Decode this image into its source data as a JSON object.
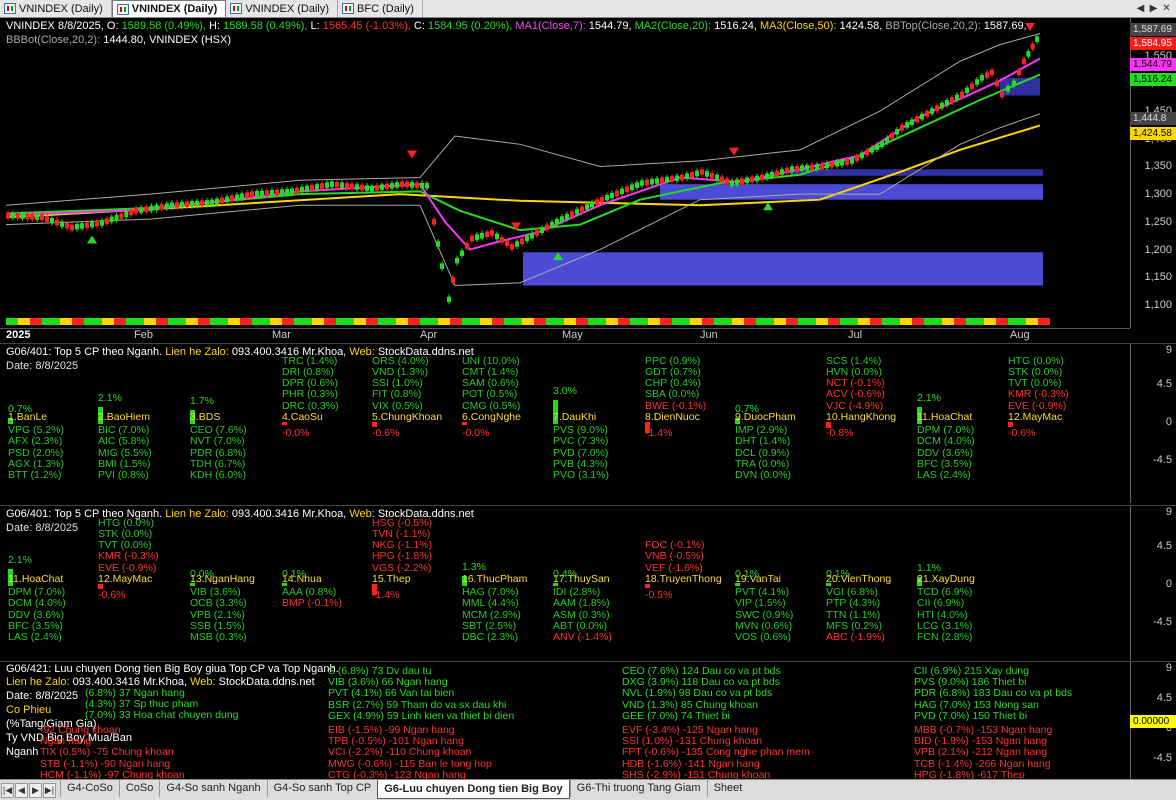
{
  "window_tabs": [
    {
      "label": "VNINDEX (Daily)",
      "active": false
    },
    {
      "label": "VNINDEX (Daily)",
      "active": true
    },
    {
      "label": "VNINDEX (Daily)",
      "active": false
    },
    {
      "label": "BFC (Daily)",
      "active": false
    }
  ],
  "price_header": {
    "line1": [
      {
        "t": "VNINDEX 8/8/2025, ",
        "c": "w"
      },
      {
        "t": "O: ",
        "c": "w"
      },
      {
        "t": "1589.58 (0.49%), ",
        "c": "g"
      },
      {
        "t": "H: ",
        "c": "w"
      },
      {
        "t": "1589.58 (0.49%), ",
        "c": "g"
      },
      {
        "t": "L: ",
        "c": "w"
      },
      {
        "t": "1565.45 (-1.03%), ",
        "c": "r"
      },
      {
        "t": "C: ",
        "c": "w"
      },
      {
        "t": "1584.95 (0.20%), ",
        "c": "g"
      },
      {
        "t": "MA1(Close,7): ",
        "c": "m"
      },
      {
        "t": "1544.79, ",
        "c": "w"
      },
      {
        "t": "MA2(Close,20): ",
        "c": "g"
      },
      {
        "t": "1516.24, ",
        "c": "w"
      },
      {
        "t": "MA3(Close,50): ",
        "c": "o"
      },
      {
        "t": "1424.58, ",
        "c": "w"
      },
      {
        "t": "BBTop(Close,20,2): ",
        "c": "gg"
      },
      {
        "t": "1587.69,",
        "c": "w"
      }
    ],
    "line2": [
      {
        "t": "BBBot(Close,20,2): ",
        "c": "gg"
      },
      {
        "t": "1444.80, ",
        "c": "w"
      },
      {
        "t": "VNINDEX (HSX)",
        "c": "w"
      }
    ]
  },
  "price_scale": {
    "ticks": [
      "1,550",
      "1,500",
      "1,450",
      "1,400",
      "1,350",
      "1,300",
      "1,250",
      "1,200",
      "1,150",
      "1,100"
    ],
    "tags": [
      {
        "label": "1,587.69",
        "bg": "#444444",
        "fg": "#dddddd"
      },
      {
        "label": "1,584.95",
        "bg": "#ff1a1a",
        "fg": "#ffffff"
      },
      {
        "label": "1,544.79",
        "bg": "#ff33ff",
        "fg": "#000000"
      },
      {
        "label": "1,516.24",
        "bg": "#22dd22",
        "fg": "#000000"
      },
      {
        "label": "1,444.8",
        "bg": "#444444",
        "fg": "#dddddd"
      },
      {
        "label": "1,424.58",
        "bg": "#ffd700",
        "fg": "#000000"
      }
    ]
  },
  "dates": [
    "2025",
    "Feb",
    "Mar",
    "Apr",
    "May",
    "Jun",
    "Jul",
    "Aug"
  ],
  "ind1": {
    "title": [
      {
        "t": "G06/401: Top 5 CP theo Nganh. ",
        "c": "w"
      },
      {
        "t": "Lien he Zalo: ",
        "c": "o"
      },
      {
        "t": "093.400.3416 Mr.Khoa, ",
        "c": "w"
      },
      {
        "t": "Web: ",
        "c": "o"
      },
      {
        "t": "StockData.ddns.net",
        "c": "w"
      }
    ],
    "date": "Date: 8/8/2025",
    "scale": [
      "9",
      "4.5",
      "0",
      "-4.5"
    ],
    "sectors": [
      {
        "name": "1.BanLe",
        "pct": "0.7%",
        "neg": false,
        "above": [],
        "below": [
          "VPG (5.2%)",
          "AFX (2.3%)",
          "PSD (2.0%)",
          "AGX (1.3%)",
          "BTT (1.2%)"
        ]
      },
      {
        "name": "2.BaoHiem",
        "pct": "2.1%",
        "neg": false,
        "above": [],
        "below": [
          "BIC (7.0%)",
          "AIC (5.8%)",
          "MIG (5.5%)",
          "BMI (1.5%)",
          "PVI (0.8%)"
        ]
      },
      {
        "name": "3.BDS",
        "pct": "1.7%",
        "neg": false,
        "above": [],
        "below": [
          "CEO (7.6%)",
          "NVT (7.0%)",
          "PDR (6.8%)",
          "TDH (6.7%)",
          "KDH (6.0%)"
        ]
      },
      {
        "name": "4.CaoSu",
        "pct": "-0.0%",
        "neg": true,
        "above": [
          "TRC (1.4%)",
          "DRI (0.8%)",
          "DPR (0.6%)",
          "PHR (0.3%)",
          "DRC (0.3%)"
        ],
        "below": []
      },
      {
        "name": "5.ChungKhoan",
        "pct": "-0.6%",
        "neg": true,
        "above": [
          "ORS (4.0%)",
          "VND (1.3%)",
          "SSI (1.0%)",
          "FIT (0.8%)",
          "VIX (0.5%)"
        ],
        "below": []
      },
      {
        "name": "6.CongNghe",
        "pct": "-0.0%",
        "neg": true,
        "above": [
          "UNI (10.0%)",
          "CMT (1.4%)",
          "SAM (0.6%)",
          "POT (0.5%)",
          "CMG (0.5%)"
        ],
        "below": []
      },
      {
        "name": "7.DauKhi",
        "pct": "3.0%",
        "neg": false,
        "above": [],
        "below": [
          "PVS (9.0%)",
          "PVC (7.3%)",
          "PVD (7.0%)",
          "PVB (4.3%)",
          "PVO (3.1%)"
        ]
      },
      {
        "name": "8.DienNuoc",
        "pct": "-1.4%",
        "neg": true,
        "above": [
          "PPC (0.9%)",
          "GDT (0.7%)",
          "CHP (0.4%)",
          "SBA (0.0%)",
          "BWE (-0.1%)"
        ],
        "below": []
      },
      {
        "name": "9.DuocPham",
        "pct": "0.7%",
        "neg": false,
        "above": [],
        "below": [
          "IMP (2.9%)",
          "DHT (1.4%)",
          "DCL (0.9%)",
          "TRA (0.0%)",
          "DVN (0.0%)"
        ]
      },
      {
        "name": "10.HangKhong",
        "pct": "-0.8%",
        "neg": true,
        "above": [
          "SCS (1.4%)",
          "HVN (0.0%)",
          "NCT (-0.1%)",
          "ACV (-0.6%)",
          "VJC (-4.9%)"
        ],
        "below": []
      },
      {
        "name": "11.HoaChat",
        "pct": "2.1%",
        "neg": false,
        "above": [],
        "below": [
          "DPM (7.0%)",
          "DCM (4.0%)",
          "DDV (3.6%)",
          "BFC (3.5%)",
          "LAS (2.4%)"
        ]
      },
      {
        "name": "12.MayMac",
        "pct": "-0.6%",
        "neg": true,
        "above": [
          "HTG (0.0%)",
          "STK (0.0%)",
          "TVT (0.0%)",
          "KMR (-0.3%)",
          "EVE (-0.9%)"
        ],
        "below": []
      }
    ]
  },
  "ind2": {
    "title": [
      {
        "t": "G06/401: Top 5 CP theo Nganh. ",
        "c": "w"
      },
      {
        "t": "Lien he Zalo: ",
        "c": "o"
      },
      {
        "t": "093.400.3416 Mr.Khoa, ",
        "c": "w"
      },
      {
        "t": "Web: ",
        "c": "o"
      },
      {
        "t": "StockData.ddns.net",
        "c": "w"
      }
    ],
    "date": "Date: 8/8/2025",
    "scale": [
      "9",
      "4.5",
      "0",
      "-4.5"
    ],
    "sectors": [
      {
        "name": "11.HoaChat",
        "pct": "2.1%",
        "neg": false,
        "above": [],
        "below": [
          "DPM (7.0%)",
          "DCM (4.0%)",
          "DDV (3.6%)",
          "BFC (3.5%)",
          "LAS (2.4%)"
        ]
      },
      {
        "name": "12.MayMac",
        "pct": "-0.6%",
        "neg": true,
        "above": [
          "HTG (0.0%)",
          "STK (0.0%)",
          "TVT (0.0%)",
          "KMR (-0.3%)",
          "EVE (-0.9%)"
        ],
        "below": []
      },
      {
        "name": "13.NganHang",
        "pct": "0.0%",
        "neg": false,
        "above": [],
        "below": [
          "VIB (3.6%)",
          "OCB (3.3%)",
          "VPB (2.1%)",
          "SSB (1.5%)",
          "MSB (0.3%)"
        ]
      },
      {
        "name": "14.Nhua",
        "pct": "0.1%",
        "neg": false,
        "above": [],
        "below": [
          "AAA (0.8%)",
          "BMP (-0.1%)"
        ]
      },
      {
        "name": "15.Thep",
        "pct": "-1.4%",
        "neg": true,
        "above": [
          "HSG (-0.5%)",
          "TVN (-1.1%)",
          "NKG (-1.1%)",
          "HPG (-1.8%)",
          "VGS (-2.2%)"
        ],
        "below": []
      },
      {
        "name": "16.ThucPham",
        "pct": "1.3%",
        "neg": false,
        "above": [],
        "below": [
          "HAG (7.0%)",
          "MML (4.4%)",
          "MCM (2.9%)",
          "SBT (2.5%)",
          "DBC (2.3%)"
        ]
      },
      {
        "name": "17.ThuySan",
        "pct": "0.4%",
        "neg": false,
        "above": [],
        "below": [
          "IDI (2.8%)",
          "AAM (1.8%)",
          "ASM (0.3%)",
          "ABT (0.0%)",
          "ANV (-1.4%)"
        ]
      },
      {
        "name": "18.TruyenThong",
        "pct": "-0.5%",
        "neg": true,
        "above": [
          "FOC (-0.1%)",
          "VNB (-0.5%)",
          "VEF (-1.6%)"
        ],
        "below": []
      },
      {
        "name": "19.VanTai",
        "pct": "0.1%",
        "neg": false,
        "above": [],
        "below": [
          "PVT (4.1%)",
          "VIP (1.5%)",
          "SWC (0.9%)",
          "MVN (0.6%)",
          "VOS (0.6%)"
        ]
      },
      {
        "name": "20.VienThong",
        "pct": "0.1%",
        "neg": false,
        "above": [],
        "below": [
          "VGI (6.8%)",
          "PTP (4.3%)",
          "TTN (1.1%)",
          "MFS (0.2%)",
          "ABC (-1.9%)"
        ]
      },
      {
        "name": "21.XayDung",
        "pct": "1.1%",
        "neg": false,
        "above": [],
        "below": [
          "TCD (6.9%)",
          "CII (6.9%)",
          "HTI (4.0%)",
          "LCG (3.1%)",
          "FCN (2.8%)"
        ]
      }
    ]
  },
  "ind3": {
    "title": "G06/421: Luu chuyen Dong tien Big Boy giua Top CP va Top Nganh.",
    "zalo_label": "Lien he Zalo: ",
    "zalo": "093.400.3416 Mr.Khoa, ",
    "web_label": "Web: ",
    "web": "StockData.ddns.net",
    "date": "Date: 8/8/2025",
    "co_phieu": "Co Phieu",
    "pct_label": "(%Tang/Giam Gia)",
    "vnd_label": "Ty VND Big Boy Mua/Ban",
    "nganh_label": "Nganh",
    "value_tag": "0.00000",
    "scale": [
      "9",
      "4.5",
      "0",
      "-4.5"
    ],
    "buy_cols": [
      [
        "(6.8%) 37   Ngan hang",
        "(4.3%) 37   Sp thuc pham",
        "(7.0%) 33   Hoa chat chuyen dung"
      ],
      [
        "S (6.8%) 73   Dv dau tu",
        "VIB (3.6%) 66   Ngan hang",
        "PVT (4.1%) 66   Van tai bien",
        "BSR (2.7%) 59   Tham do va sx dau khi",
        "GEX (4.9%) 59   Linh kien va thiet bi dien"
      ],
      [
        "CEO (7.6%) 124   Dau co va pt bds",
        "DXG (3.9%) 118   Dau co va pt bds",
        "NVL (1.9%) 98   Dau co va pt bds",
        "VND (1.3%) 85   Chung khoan",
        "GEE (7.0%) 74   Thiet bi"
      ],
      [
        "CII (6.9%) 215   Xay dung",
        "PVS (9.0%) 186   Thiet bi",
        "PDR (6.8%) 183   Dau co va pt bds",
        "HAG (7.0%) 153   Nong san",
        "PVD (7.0%) 150   Thiet bi"
      ]
    ],
    "sell_cols": [
      [
        "-92   Chung khoan",
        "Ngan hang",
        "TIX (0.5%) -75   Chung khoan",
        "STB (-1.1%) -90   Ngan hang",
        "HCM (-1.1%) -97   Chung khoan"
      ],
      [
        "EIB (-1.5%) -99   Ngan hang",
        "TPB (-0.5%) -101   Ngan hang",
        "VCI (-2.2%) -110   Chung khoan",
        "MWG (-0.6%) -115   Ban le tong hop",
        "CTG (-0.3%) -123   Ngan hang"
      ],
      [
        "EVF (-3.4%) -125   Ngan hang",
        "SSI (1.0%) -131   Chung khoan",
        "FPT (-0.6%) -135   Cong nghe phan mem",
        "HDB (-1.6%) -141   Ngan hang",
        "SHS (-2.9%) -151   Chung khoan"
      ],
      [
        "MBB (-0.7%) -153   Ngan hang",
        "BID (-1.9%) -153   Ngan hang",
        "VPB (2.1%) -212   Ngan hang",
        "TCB (-1.4%) -266   Ngan hang",
        "HPG (-1.8%) -617   Thep"
      ]
    ]
  },
  "sheet_tabs": [
    {
      "label": "G4-CoSo",
      "active": false
    },
    {
      "label": "CoSo",
      "active": false
    },
    {
      "label": "G4-So sanh Nganh",
      "active": false
    },
    {
      "label": "G4-So sanh Top CP",
      "active": false
    },
    {
      "label": "G6-Luu chuyen Dong tien Big Boy",
      "active": true
    },
    {
      "label": "G6-Thi truong Tang Giam",
      "active": false
    },
    {
      "label": "Sheet",
      "active": false
    }
  ],
  "colors": {
    "up": "#22dd22",
    "down": "#ff2020",
    "ma1": "#ff33ff",
    "ma2": "#22dd22",
    "ma3": "#ffd700",
    "bb": "#aaaaaa",
    "box": "#4b4bd6"
  }
}
